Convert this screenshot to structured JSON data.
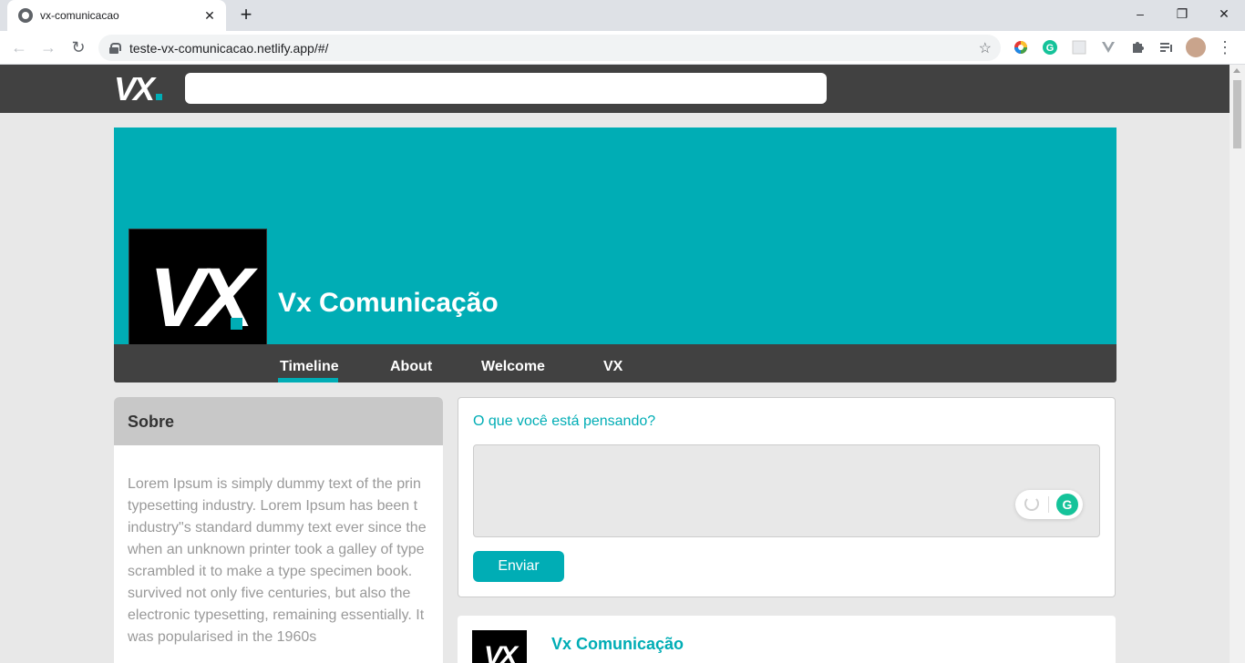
{
  "browser": {
    "tab_title": "vx-comunicacao",
    "tab_close": "✕",
    "new_tab": "+",
    "url": "teste-vx-comunicacao.netlify.app/#/",
    "window_controls": {
      "minimize": "–",
      "restore": "❐",
      "close": "✕"
    },
    "nav": {
      "back": "←",
      "forward": "→",
      "reload": "↻"
    },
    "star": "☆",
    "menu": "⋮"
  },
  "site": {
    "logo_text": "VX",
    "search_value": ""
  },
  "profile": {
    "name": "Vx Comunicação",
    "avatar_text": "VX",
    "nav": [
      "Timeline",
      "About",
      "Welcome",
      "VX"
    ],
    "active_tab": "Timeline"
  },
  "sobre": {
    "title": "Sobre",
    "text": "Lorem Ipsum is simply dummy text of the prin\ntypesetting industry. Lorem Ipsum has been t\nindustry\"s standard dummy text ever since the\nwhen an unknown printer took a galley of type\nscrambled it to make a type specimen book.\nsurvived not only five centuries, but also the\nelectronic typesetting, remaining essentially. It\nwas popularised in the 1960s"
  },
  "post_box": {
    "prompt": "O que você está pensando?",
    "input_value": "",
    "send_label": "Enviar"
  },
  "feed": [
    {
      "author": "Vx Comunicação",
      "avatar_text": "VX"
    }
  ],
  "colors": {
    "accent": "#00adb5",
    "dark_bar": "#414141",
    "background": "#e8e8e8"
  }
}
